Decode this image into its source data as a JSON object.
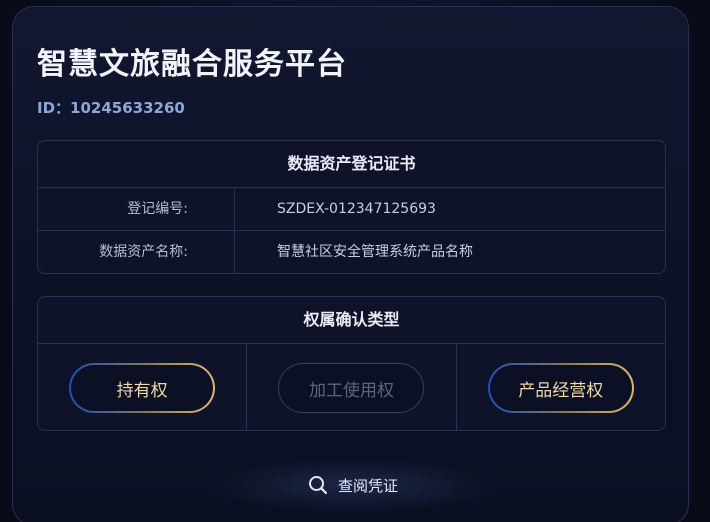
{
  "header": {
    "title": "智慧文旅融合服务平台",
    "id_text": "ID：10245633260"
  },
  "certificate": {
    "heading": "数据资产登记证书",
    "rows": [
      {
        "label": "登记编号:",
        "value": "SZDEX-012347125693"
      },
      {
        "label": "数据资产名称:",
        "value": "智慧社区安全管理系统产品名称"
      }
    ]
  },
  "rights": {
    "heading": "权属确认类型",
    "options": [
      {
        "label": "持有权",
        "state": "active"
      },
      {
        "label": "加工使用权",
        "state": "disabled"
      },
      {
        "label": "产品经营权",
        "state": "active"
      }
    ]
  },
  "footer": {
    "button_label": "查阅凭证",
    "icon": "search-icon"
  },
  "colors": {
    "background": "#0d1126",
    "accent_gold": "#e0b56c",
    "accent_blue": "#1f4fb8",
    "id_text": "#8fa6d8"
  }
}
